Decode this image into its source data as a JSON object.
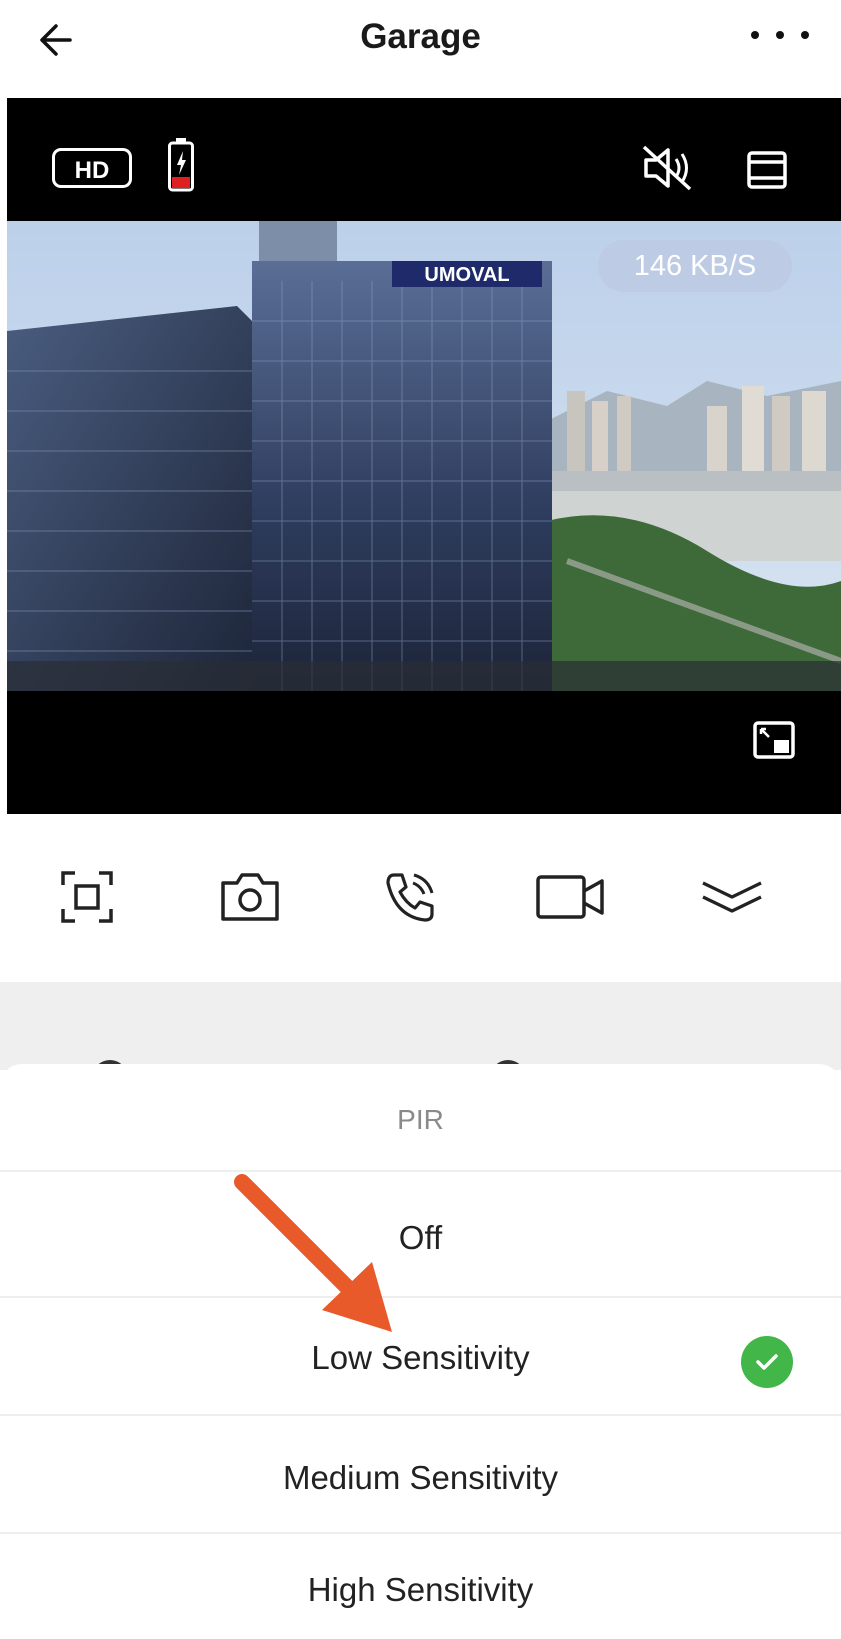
{
  "header": {
    "title": "Garage",
    "back_icon": "arrow-left-icon",
    "more_icon": "ellipsis-icon"
  },
  "video": {
    "quality_label": "HD",
    "battery_level": 0.25,
    "battery_color": "#e02020",
    "bitrate": "146 KB/S",
    "building_sign": "UMOVAL"
  },
  "toolbar": [
    "fullscreen-icon",
    "snapshot-camera-icon",
    "call-icon",
    "record-video-icon",
    "collapse-chevron-icon"
  ],
  "sheet": {
    "title": "PIR",
    "options": [
      {
        "label": "Off",
        "selected": false
      },
      {
        "label": "Low Sensitivity",
        "selected": true
      },
      {
        "label": "Medium Sensitivity",
        "selected": false
      },
      {
        "label": "High Sensitivity",
        "selected": false
      }
    ]
  },
  "colors": {
    "accent_check": "#43b649",
    "annotation_arrow": "#e85a2a"
  }
}
